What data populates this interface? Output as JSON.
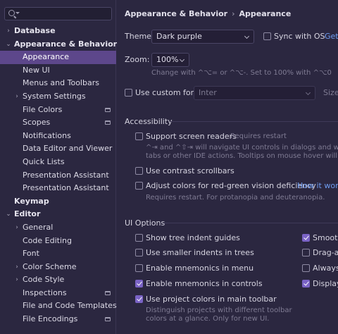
{
  "sidebar": {
    "search_placeholder": "",
    "items": [
      {
        "label": "Database",
        "bold": true,
        "arrow": "›",
        "level": 0
      },
      {
        "label": "Appearance & Behavior",
        "bold": true,
        "arrow": "⌄",
        "level": 0
      },
      {
        "label": "Appearance",
        "level": 1,
        "selected": true
      },
      {
        "label": "New UI",
        "level": 1
      },
      {
        "label": "Menus and Toolbars",
        "level": 1
      },
      {
        "label": "System Settings",
        "level": 1,
        "arrow": "›"
      },
      {
        "label": "File Colors",
        "level": 1,
        "icon": true
      },
      {
        "label": "Scopes",
        "level": 1,
        "icon": true
      },
      {
        "label": "Notifications",
        "level": 1
      },
      {
        "label": "Data Editor and Viewer",
        "level": 1
      },
      {
        "label": "Quick Lists",
        "level": 1
      },
      {
        "label": "Presentation Assistant",
        "level": 1
      },
      {
        "label": "Presentation Assistant",
        "level": 1
      },
      {
        "label": "Keymap",
        "bold": true,
        "level": 0
      },
      {
        "label": "Editor",
        "bold": true,
        "arrow": "⌄",
        "level": 0
      },
      {
        "label": "General",
        "level": 1,
        "arrow": "›"
      },
      {
        "label": "Code Editing",
        "level": 1
      },
      {
        "label": "Font",
        "level": 1
      },
      {
        "label": "Color Scheme",
        "level": 1,
        "arrow": "›"
      },
      {
        "label": "Code Style",
        "level": 1,
        "arrow": "›"
      },
      {
        "label": "Inspections",
        "level": 1,
        "icon": true
      },
      {
        "label": "File and Code Templates",
        "level": 1
      },
      {
        "label": "File Encodings",
        "level": 1,
        "icon": true
      }
    ]
  },
  "breadcrumb": {
    "parent": "Appearance & Behavior",
    "separator": "›",
    "current": "Appearance"
  },
  "theme": {
    "label": "Theme:",
    "value": "Dark purple",
    "sync_label": "Sync with OS",
    "get_link": "Get"
  },
  "zoom": {
    "label": "Zoom:",
    "value": "100%",
    "hint": "Change with ^⌥= or ^⌥-. Set to 100% with ^⌥0"
  },
  "custom_font": {
    "label": "Use custom font:",
    "value": "Inter",
    "size_label": "Size"
  },
  "accessibility": {
    "title": "Accessibility",
    "screen_readers": "Support screen readers",
    "requires_restart": "Requires restart",
    "screen_readers_hint_1": "^⇥ and ^⇧⇥ will navigate UI controls in dialogs and will not be",
    "screen_readers_hint_2": "tabs or other IDE actions. Tooltips on mouse hover will be disable",
    "contrast_scrollbars": "Use contrast scrollbars",
    "color_deficiency": "Adjust colors for red-green vision deficiency",
    "how_it_works": "How it works",
    "deficiency_hint": "Requires restart. For protanopia and deuteranopia."
  },
  "ui_options": {
    "title": "UI Options",
    "tree_indent": "Show tree indent guides",
    "smaller_indents": "Use smaller indents in trees",
    "mnemonics_menu": "Enable mnemonics in menu",
    "mnemonics_controls": "Enable mnemonics in controls",
    "project_colors": "Use project colors in main toolbar",
    "project_colors_hint_1": "Distinguish projects with different toolbar",
    "project_colors_hint_2": "colors at a glance. Only for new UI.",
    "right_smooth": "Smooth",
    "right_drag": "Drag-a",
    "right_always": "Always",
    "right_display": "Display"
  },
  "colors": {
    "accent": "#5d478b",
    "link": "#6f9cf0",
    "checkbox_checked": "#7a63c5"
  }
}
